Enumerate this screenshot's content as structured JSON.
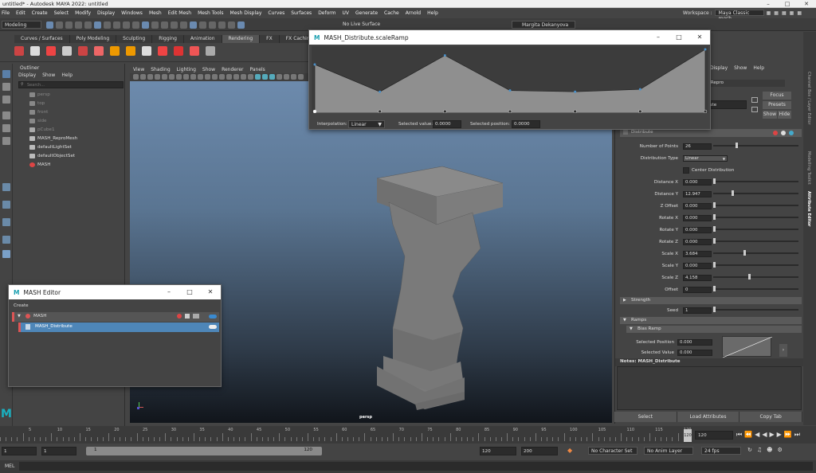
{
  "window": {
    "title": "untitled* - Autodesk MAYA 2022: untitled"
  },
  "menu": [
    "File",
    "Edit",
    "Create",
    "Select",
    "Modify",
    "Display",
    "Windows",
    "Mesh",
    "Edit Mesh",
    "Mesh Tools",
    "Mesh Display",
    "Curves",
    "Surfaces",
    "Deform",
    "UV",
    "Generate",
    "Cache",
    "Arnold",
    "Help"
  ],
  "workspace": {
    "label": "Workspace :",
    "value": "Maya Classic mesh"
  },
  "statusline": {
    "mode": "Modeling",
    "live_surface": "No Live Surface",
    "user": "Margita Dekanyova"
  },
  "shelf_tabs": [
    "Curves / Surfaces",
    "Poly Modeling",
    "Sculpting",
    "Rigging",
    "Animation",
    "Rendering",
    "FX",
    "FX Caching",
    "Cu"
  ],
  "outliner": {
    "title": "Outliner",
    "menu": [
      "Display",
      "Show",
      "Help"
    ],
    "search_placeholder": "Search...",
    "items": [
      "persp",
      "top",
      "front",
      "side",
      "pCube1",
      "MASH_ReproMesh",
      "defaultLightSet",
      "defaultObjectSet",
      "MASH"
    ]
  },
  "viewport": {
    "menu": [
      "View",
      "Shading",
      "Lighting",
      "Show",
      "Renderer",
      "Panels"
    ],
    "camera": "persp"
  },
  "ramp_window": {
    "title": "MASH_Distribute.scaleRamp",
    "interp_label": "Interpolation:",
    "interp_value": "Linear",
    "sel_value_label": "Selected value:",
    "sel_value": "0.0000",
    "sel_pos_label": "Selected position:",
    "sel_pos": "0.0000",
    "points": [
      0.75,
      0.3,
      0.9,
      0.32,
      0.3,
      0.34,
      1.0
    ]
  },
  "mash_editor": {
    "title": "MASH Editor",
    "menu": "Create",
    "network": "MASH",
    "node": "MASH_Distribute"
  },
  "attr_editor": {
    "menu": [
      "Display",
      "Show",
      "Help"
    ],
    "node_field": "_Repro",
    "node_field2": "ute",
    "buttons": [
      "Focus",
      "Presets"
    ],
    "show": "Show",
    "hide": "Hide",
    "section": "Distribute",
    "rows": [
      {
        "label": "Number of Points",
        "value": "26",
        "knob": 0.27
      },
      {
        "label": "Distribution Type",
        "value": "Linear",
        "dropdown": true
      },
      {
        "label": "Center Distribution",
        "checkbox": true
      },
      {
        "label": "Distance X",
        "value": "0.000",
        "knob": 0.0
      },
      {
        "label": "Distance Y",
        "value": "12.947",
        "knob": 0.22
      },
      {
        "label": "Z Offset",
        "value": "0.000",
        "knob": 0.0
      },
      {
        "label": "Rotate X",
        "value": "0.000",
        "knob": 0.0
      },
      {
        "label": "Rotate Y",
        "value": "0.000",
        "knob": 0.0
      },
      {
        "label": "Rotate Z",
        "value": "0.000",
        "knob": 0.0
      },
      {
        "label": "Scale X",
        "value": "3.684",
        "knob": 0.37
      },
      {
        "label": "Scale Y",
        "value": "0.000",
        "knob": 0.0
      },
      {
        "label": "Scale Z",
        "value": "4.158",
        "knob": 0.42
      },
      {
        "label": "Offset",
        "value": "0",
        "knob": 0.0
      }
    ],
    "strength": "Strength",
    "seed_label": "Seed",
    "seed_value": "1",
    "ramps": "Ramps",
    "bias_ramp": "Bias Ramp",
    "sel_pos_label": "Selected Position",
    "sel_pos": "0.000",
    "sel_val_label": "Selected Value",
    "sel_val": "0.000",
    "notes": "Notes:  MASH_Distribute",
    "bottom": [
      "Select",
      "Load Attributes",
      "Copy Tab"
    ]
  },
  "right_tabs": [
    "Channel Box / Layer Editor",
    "Modelling Toolkit",
    "Attribute Editor"
  ],
  "timeline": {
    "ticks": [
      "5",
      "10",
      "15",
      "20",
      "25",
      "30",
      "35",
      "40",
      "45",
      "50",
      "55",
      "60",
      "65",
      "70",
      "75",
      "80",
      "85",
      "90",
      "95",
      "100",
      "105",
      "110",
      "115",
      "120"
    ],
    "current": "120",
    "current_field": "120"
  },
  "range": {
    "start": "1",
    "start2": "1",
    "slider_start": "1",
    "slider_end": "120",
    "end": "120",
    "end2": "200",
    "character": "No Character Set",
    "anim_layer": "No Anim Layer",
    "fps": "24 fps"
  },
  "cmd": {
    "label": "MEL"
  }
}
